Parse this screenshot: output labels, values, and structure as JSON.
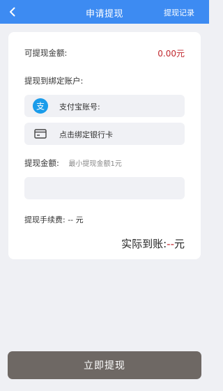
{
  "header": {
    "back_icon": "chevron-left-icon",
    "title": "申请提现",
    "records_link": "提现记录",
    "background": "#3d8bf2"
  },
  "form": {
    "available_label": "可提现金额:",
    "available_amount": "0.00元",
    "bind_account_label": "提现到绑定账户:",
    "alipay": {
      "icon": "alipay-icon",
      "label": "支付宝账号:"
    },
    "bank_card": {
      "icon": "bank-card-icon",
      "label": "点击绑定银行卡"
    },
    "amount_label": "提现金额:",
    "amount_hint": "最小提现金额1元",
    "amount_value": "",
    "fee_text": "提现手续费: -- 元",
    "actual_label": "实际到账:",
    "actual_value": "--",
    "actual_unit": "元"
  },
  "submit_button": "立即提现",
  "colors": {
    "accent": "#3d8bf2",
    "amount_red": "#c0272d",
    "submit_bg": "#6e6864",
    "page_bg": "#eff0f4"
  }
}
